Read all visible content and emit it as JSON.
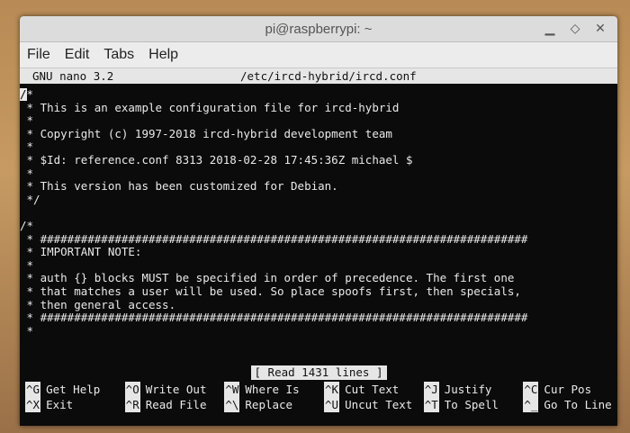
{
  "window": {
    "title": "pi@raspberrypi: ~",
    "menu": [
      "File",
      "Edit",
      "Tabs",
      "Help"
    ]
  },
  "nano": {
    "version": "GNU nano 3.2",
    "filename": "/etc/ircd-hybrid/ircd.conf",
    "lines": [
      "/*",
      " * This is an example configuration file for ircd-hybrid",
      " *",
      " * Copyright (c) 1997-2018 ircd-hybrid development team",
      " *",
      " * $Id: reference.conf 8313 2018-02-28 17:45:36Z michael $",
      " *",
      " * This version has been customized for Debian.",
      " */",
      "",
      "/*",
      " * ########################################################################",
      " * IMPORTANT NOTE:",
      " *",
      " * auth {} blocks MUST be specified in order of precedence. The first one",
      " * that matches a user will be used. So place spoofs first, then specials,",
      " * then general access.",
      " * ########################################################################",
      " *"
    ],
    "status": "[ Read 1431 lines ]",
    "shortcuts_row1": [
      {
        "key": "^G",
        "label": "Get Help"
      },
      {
        "key": "^O",
        "label": "Write Out"
      },
      {
        "key": "^W",
        "label": "Where Is"
      },
      {
        "key": "^K",
        "label": "Cut Text"
      },
      {
        "key": "^J",
        "label": "Justify"
      },
      {
        "key": "^C",
        "label": "Cur Pos"
      }
    ],
    "shortcuts_row2": [
      {
        "key": "^X",
        "label": "Exit"
      },
      {
        "key": "^R",
        "label": "Read File"
      },
      {
        "key": "^\\",
        "label": "Replace"
      },
      {
        "key": "^U",
        "label": "Uncut Text"
      },
      {
        "key": "^T",
        "label": "To Spell"
      },
      {
        "key": "^_",
        "label": "Go To Line"
      }
    ]
  }
}
